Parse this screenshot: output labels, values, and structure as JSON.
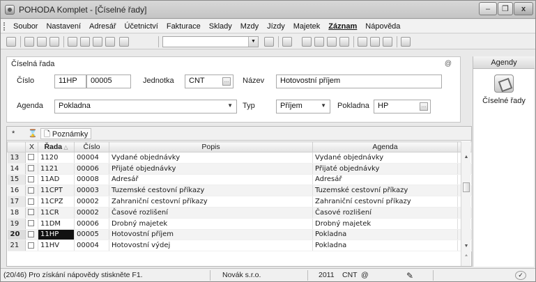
{
  "window": {
    "title": "POHODA Komplet - [Číselné řady]",
    "minimize_glyph": "–",
    "restore_glyph": "❐",
    "close_glyph": "x"
  },
  "menu": [
    "Soubor",
    "Nastavení",
    "Adresář",
    "Účetnictví",
    "Fakturace",
    "Sklady",
    "Mzdy",
    "Jízdy",
    "Majetek",
    "Záznam",
    "Nápověda"
  ],
  "form": {
    "title": "Číselná řada",
    "cislo_label": "Číslo",
    "cislo_prefix": "11HP",
    "cislo_value": "00005",
    "jednotka_label": "Jednotka",
    "jednotka_value": "CNT",
    "nazev_label": "Název",
    "nazev_value": "Hotovostní příjem",
    "agenda_label": "Agenda",
    "agenda_value": "Pokladna",
    "typ_label": "Typ",
    "typ_value": "Příjem",
    "pokladna_label": "Pokladna",
    "pokladna_value": "HP",
    "at_glyph": "@"
  },
  "right_panel": {
    "header": "Agendy",
    "item_label": "Číselné řady"
  },
  "grid": {
    "tab_star": "*",
    "tab_notes": "Poznámky",
    "columns": {
      "x": "X",
      "rada": "Řada",
      "cislo": "Číslo",
      "popis": "Popis",
      "agenda": "Agenda"
    },
    "rows": [
      {
        "num": "13",
        "rada": "1120",
        "cislo": "00004",
        "popis": "Vydané objednávky",
        "agenda": "Vydané objednávky"
      },
      {
        "num": "14",
        "rada": "1121",
        "cislo": "00006",
        "popis": "Přijaté objednávky",
        "agenda": "Přijaté objednávky"
      },
      {
        "num": "15",
        "rada": "11AD",
        "cislo": "00008",
        "popis": "Adresář",
        "agenda": "Adresář"
      },
      {
        "num": "16",
        "rada": "11CPT",
        "cislo": "00003",
        "popis": "Tuzemské cestovní příkazy",
        "agenda": "Tuzemské cestovní příkazy"
      },
      {
        "num": "17",
        "rada": "11CPZ",
        "cislo": "00002",
        "popis": "Zahraniční cestovní příkazy",
        "agenda": "Zahraniční cestovní příkazy"
      },
      {
        "num": "18",
        "rada": "11CR",
        "cislo": "00002",
        "popis": "Časové rozlišení",
        "agenda": "Časové rozlišení"
      },
      {
        "num": "19",
        "rada": "11DM",
        "cislo": "00006",
        "popis": "Drobný majetek",
        "agenda": "Drobný majetek"
      },
      {
        "num": "20",
        "rada": "11HP",
        "cislo": "00005",
        "popis": "Hotovostní příjem",
        "agenda": "Pokladna"
      },
      {
        "num": "21",
        "rada": "11HV",
        "cislo": "00004",
        "popis": "Hotovostní výdej",
        "agenda": "Pokladna"
      }
    ]
  },
  "status": {
    "hint": "(20/46) Pro získání nápovědy stiskněte F1.",
    "company": "Novák s.r.o.",
    "year": "2011",
    "unit": "CNT",
    "at": "@"
  }
}
